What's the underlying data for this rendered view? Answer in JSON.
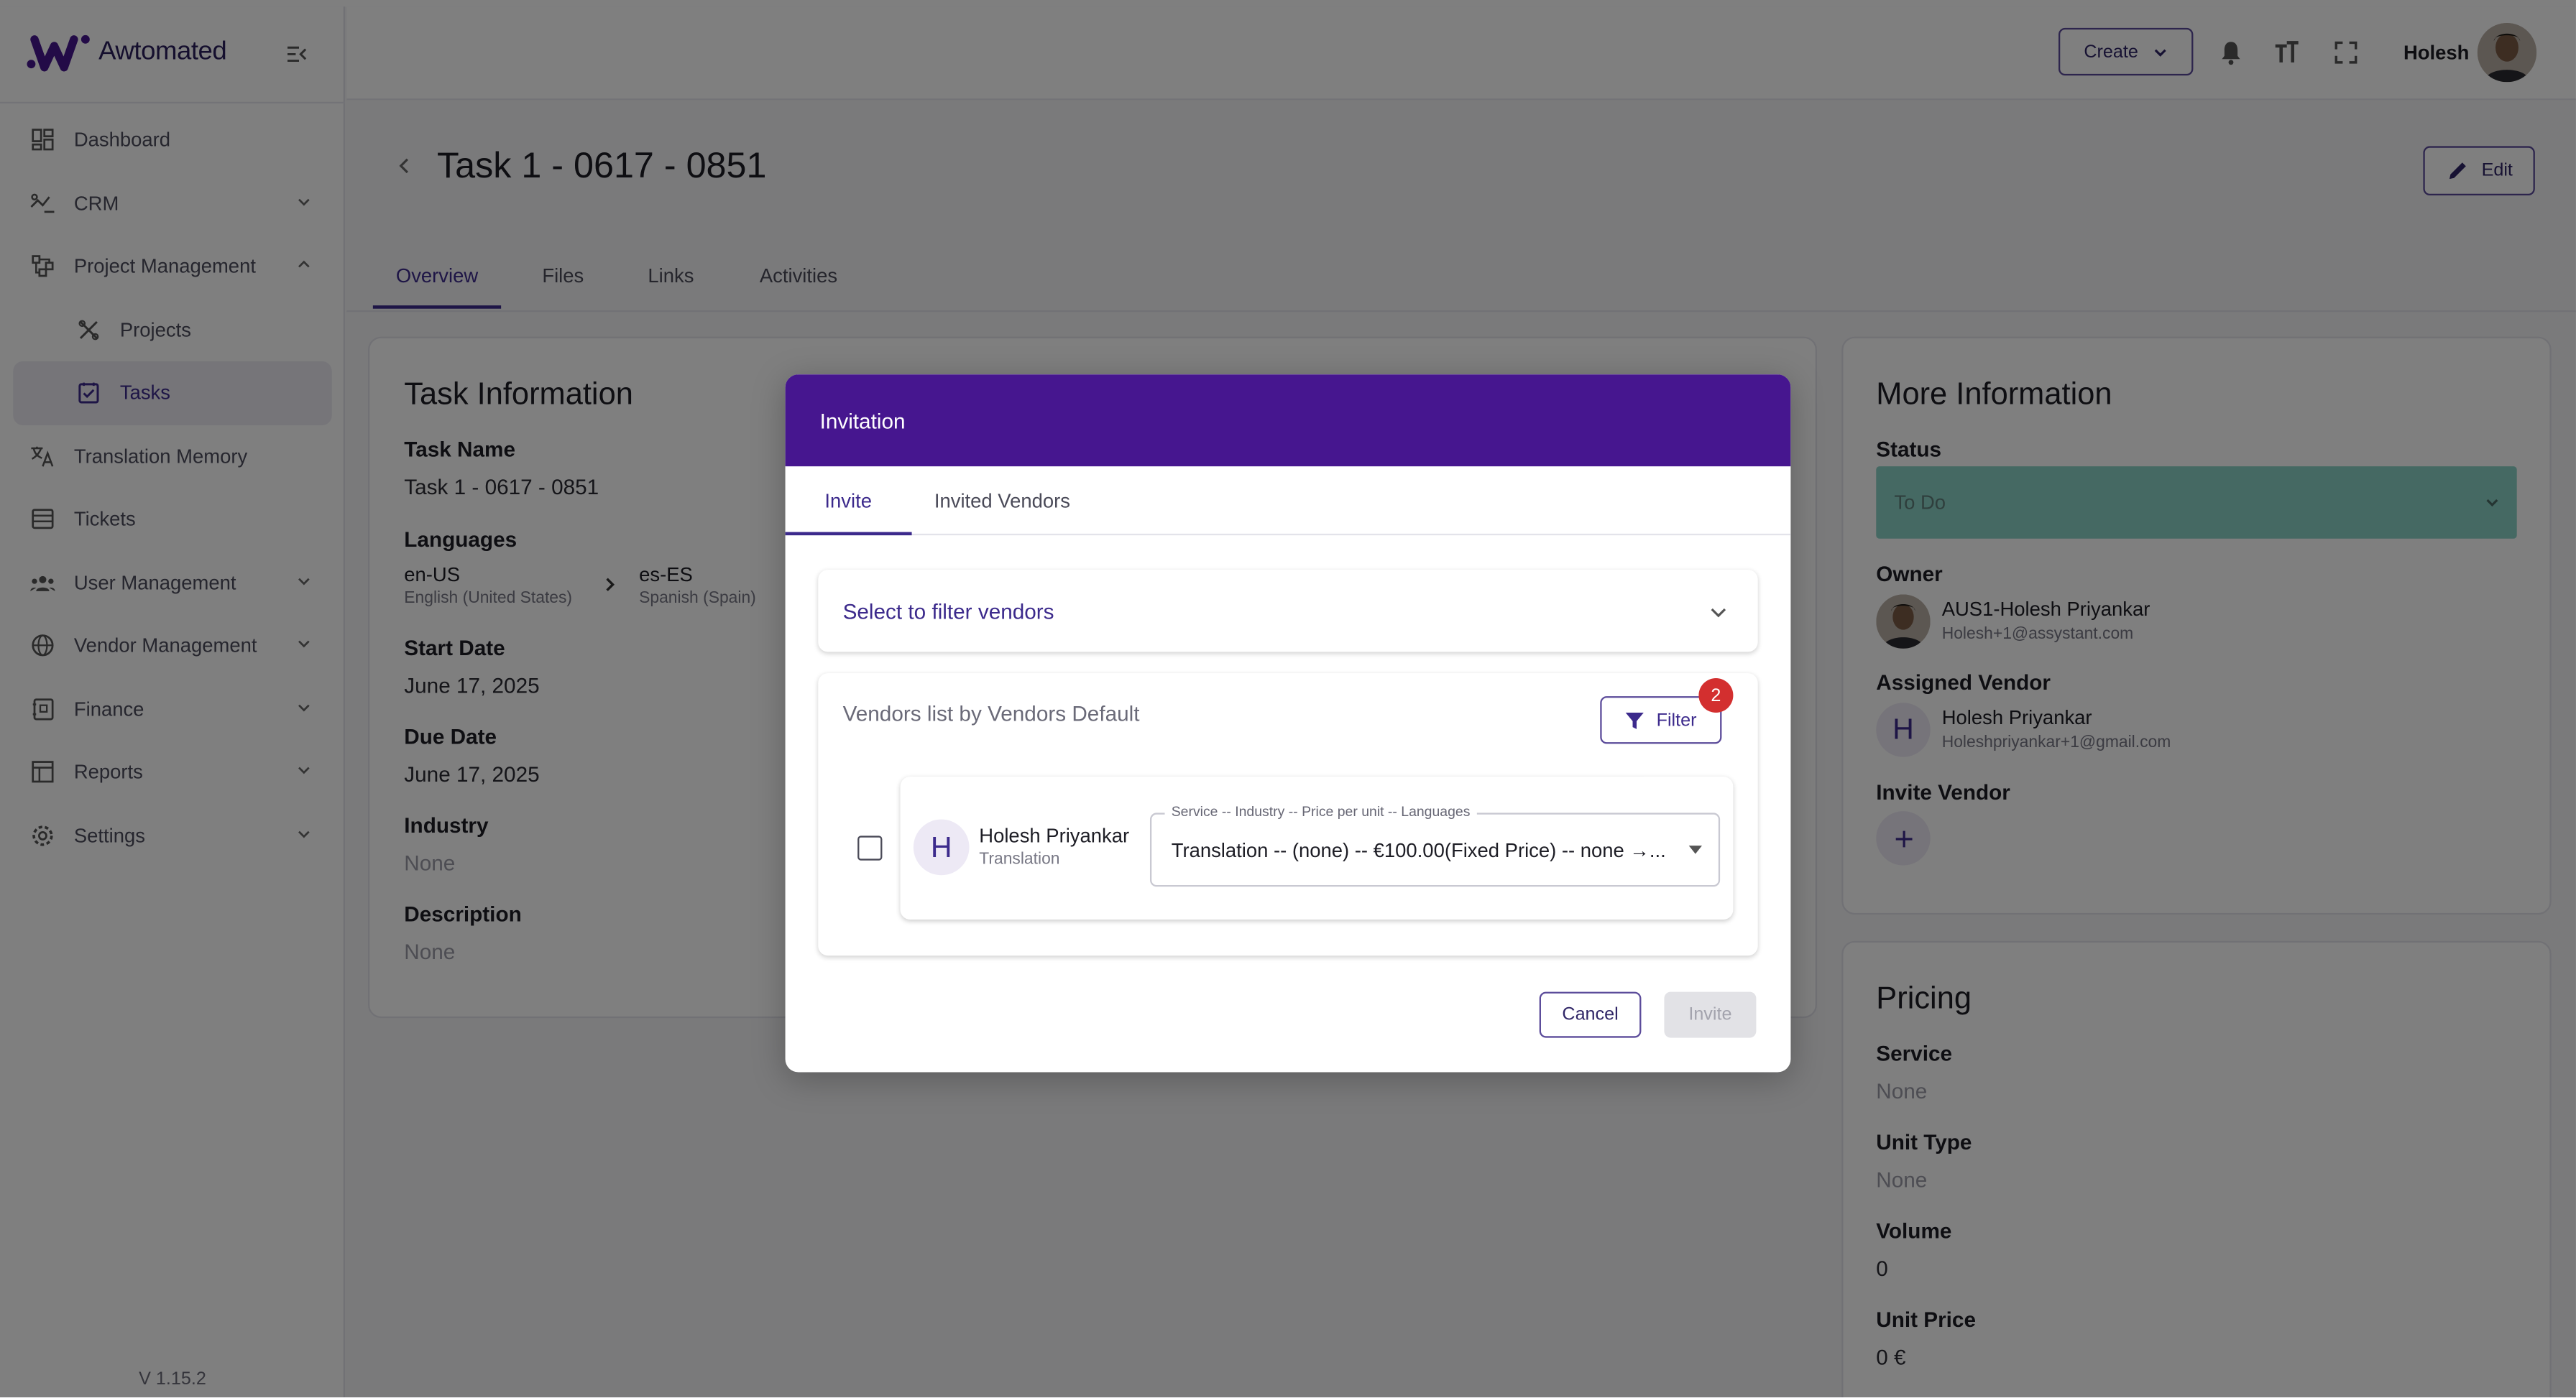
{
  "brand": {
    "name": "Awtomated",
    "accent": "#46168f"
  },
  "sidebar": {
    "items": [
      {
        "label": "Dashboard",
        "icon": "dashboard-icon"
      },
      {
        "label": "CRM",
        "icon": "crm-icon"
      },
      {
        "label": "Project Management",
        "icon": "project-icon"
      },
      {
        "label": "Projects",
        "icon": "projects-icon"
      },
      {
        "label": "Tasks",
        "icon": "tasks-icon"
      },
      {
        "label": "Translation Memory",
        "icon": "translate-icon"
      },
      {
        "label": "Tickets",
        "icon": "tickets-icon"
      },
      {
        "label": "User Management",
        "icon": "users-icon"
      },
      {
        "label": "Vendor Management",
        "icon": "globe-icon"
      },
      {
        "label": "Finance",
        "icon": "finance-icon"
      },
      {
        "label": "Reports",
        "icon": "reports-icon"
      },
      {
        "label": "Settings",
        "icon": "gear-icon"
      }
    ],
    "version": "V 1.15.2"
  },
  "header": {
    "create_label": "Create",
    "user_name": "Holesh"
  },
  "page": {
    "title": "Task 1 - 0617 - 0851",
    "edit_label": "Edit",
    "tabs": [
      "Overview",
      "Files",
      "Links",
      "Activities"
    ]
  },
  "task_info": {
    "title": "Task Information",
    "task_name_label": "Task Name",
    "task_name": "Task 1 - 0617 - 0851",
    "languages_label": "Languages",
    "source_code": "en-US",
    "source_name": "English (United States)",
    "target_code": "es-ES",
    "target_name": "Spanish (Spain)",
    "start_label": "Start Date",
    "start": "June 17, 2025",
    "due_label": "Due Date",
    "due": "June 17, 2025",
    "industry_label": "Industry",
    "industry": "None",
    "description_label": "Description",
    "description": "None"
  },
  "more_info": {
    "title": "More Information",
    "status_label": "Status",
    "status": "To Do",
    "status_color": "#8bd2c6",
    "owner_label": "Owner",
    "owner_name": "AUS1-Holesh Priyankar",
    "owner_email": "Holesh+1@assystant.com",
    "assigned_label": "Assigned Vendor",
    "assigned_initial": "H",
    "assigned_name": "Holesh Priyankar",
    "assigned_email": "Holeshpriyankar+1@gmail.com",
    "invite_label": "Invite Vendor"
  },
  "pricing": {
    "title": "Pricing",
    "service_label": "Service",
    "service": "None",
    "unit_type_label": "Unit Type",
    "unit_type": "None",
    "volume_label": "Volume",
    "volume": "0",
    "unit_price_label": "Unit Price",
    "unit_price": "0 €"
  },
  "modal": {
    "title": "Invitation",
    "tabs": [
      "Invite",
      "Invited Vendors"
    ],
    "filter_placeholder": "Select to filter vendors",
    "list_title": "Vendors list by Vendors Default",
    "filter_label": "Filter",
    "filter_count": "2",
    "vendor": {
      "initial": "H",
      "name": "Holesh Priyankar",
      "role": "Translation",
      "service_legend": "Service -- Industry -- Price per unit -- Languages",
      "service_value": "Translation -- (none) -- €100.00(Fixed Price) -- none →..."
    },
    "cancel_label": "Cancel",
    "invite_label": "Invite",
    "badge_color": "#d32f2f"
  }
}
